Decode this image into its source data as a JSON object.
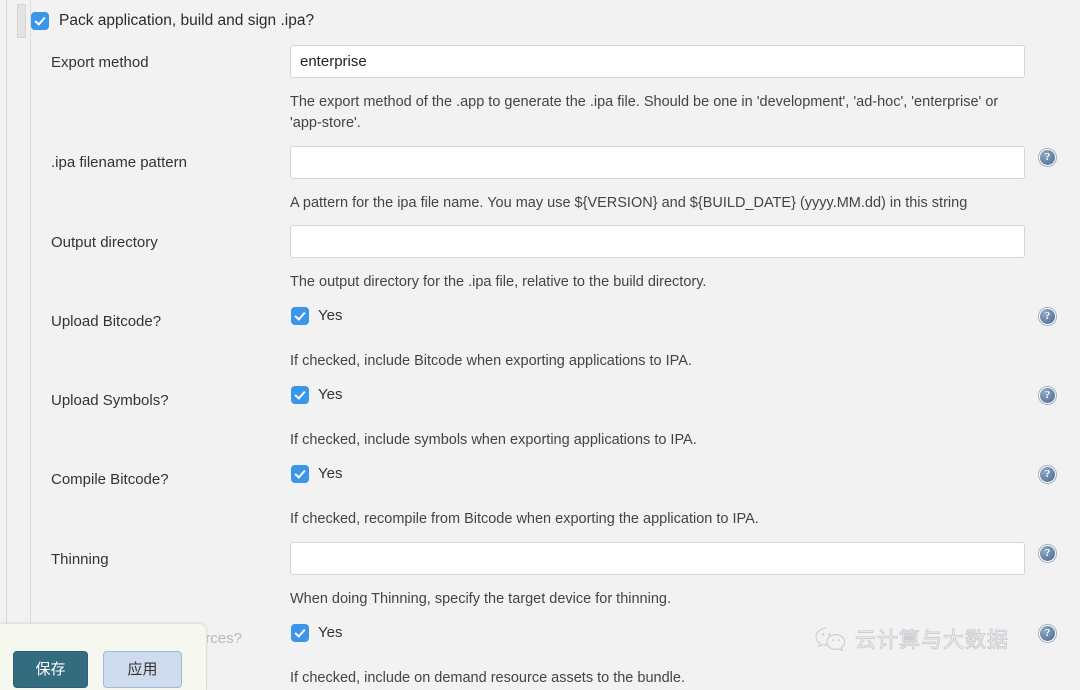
{
  "master_toggle": {
    "label": "Pack application, build and sign .ipa?",
    "checked": "true",
    "checkbox_color": "#3b95e8"
  },
  "rows": [
    {
      "label": "Export method",
      "control": "text",
      "value": "enterprise",
      "placeholder": "",
      "help": "The export method of the .app to generate the .ipa file. Should be one in 'development', 'ad-hoc', 'enterprise' or 'app-store'.",
      "help_icon": "false"
    },
    {
      "label": ".ipa filename pattern",
      "control": "text",
      "value": "",
      "placeholder": "",
      "help": "A pattern for the ipa file name. You may use ${VERSION} and ${BUILD_DATE} (yyyy.MM.dd) in this string",
      "help_icon": "true"
    },
    {
      "label": "Output directory",
      "control": "text",
      "value": "",
      "placeholder": "",
      "help": "The output directory for the .ipa file, relative to the build directory.",
      "help_icon": "false"
    },
    {
      "label": "Upload Bitcode?",
      "control": "checkbox",
      "value": "Yes",
      "checked": "true",
      "help": "If checked, include Bitcode when exporting applications to IPA.",
      "help_icon": "true"
    },
    {
      "label": "Upload Symbols?",
      "control": "checkbox",
      "value": "Yes",
      "checked": "true",
      "help": "If checked, include symbols when exporting applications to IPA.",
      "help_icon": "true"
    },
    {
      "label": "Compile Bitcode?",
      "control": "checkbox",
      "value": "Yes",
      "checked": "true",
      "help": "If checked, recompile from Bitcode when exporting the application to IPA.",
      "help_icon": "true"
    },
    {
      "label": "Thinning",
      "control": "text",
      "value": "",
      "placeholder": "",
      "help": "When doing Thinning, specify the target device for thinning.",
      "help_icon": "true"
    },
    {
      "label": "Pack on demand resources?",
      "control": "checkbox",
      "value": "Yes",
      "checked": "true",
      "help": "If checked, include on demand resource assets to the bundle.",
      "help_icon": "true"
    }
  ],
  "help_icon_glyph": "?",
  "button_bar": {
    "save_label": "保存",
    "apply_label": "应用",
    "save_color": "#336b7f",
    "apply_color": "#cfdcee"
  },
  "watermark": {
    "text": "云计算与大数据",
    "icon": "wechat-icon"
  }
}
